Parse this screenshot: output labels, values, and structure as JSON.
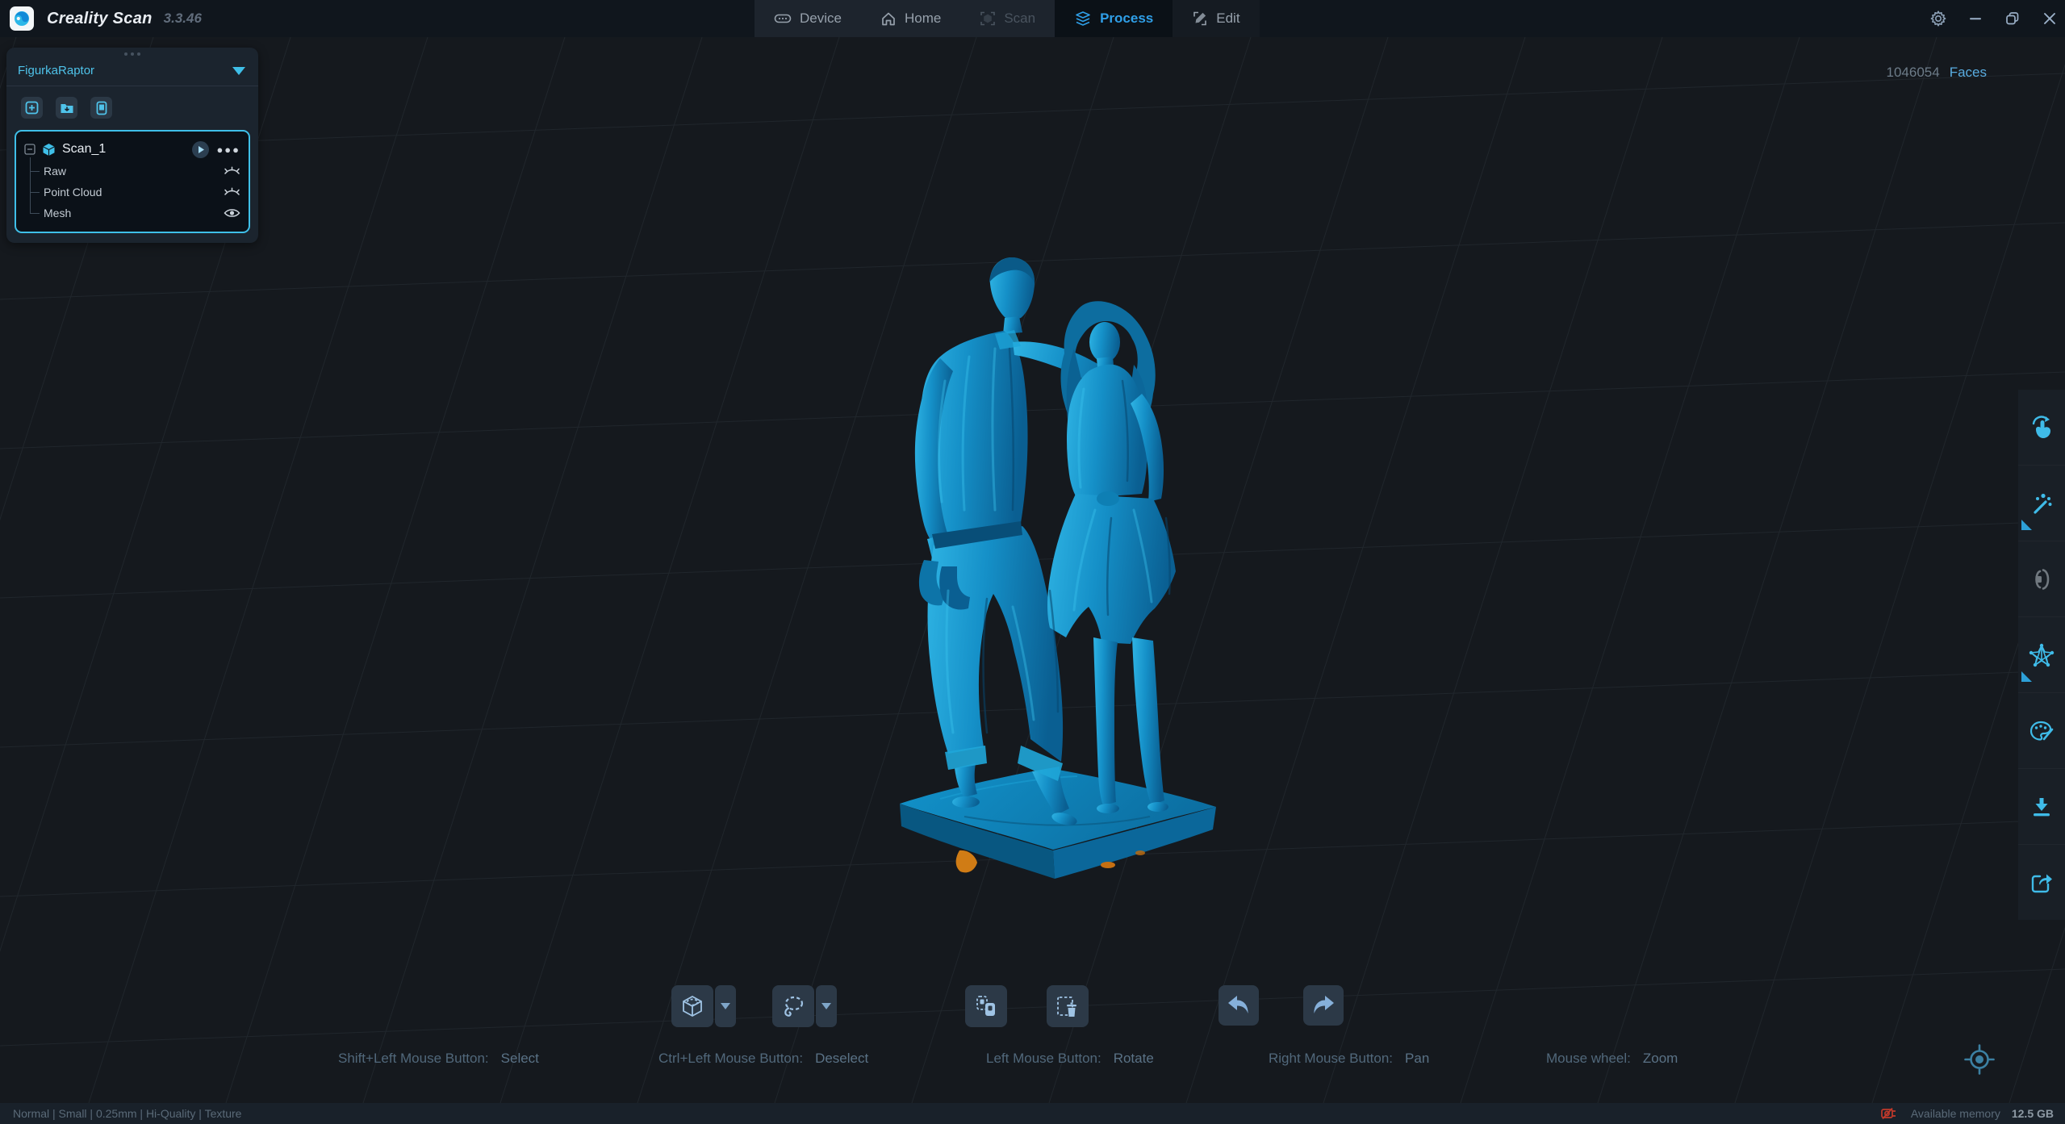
{
  "titlebar": {
    "app_name": "Creality Scan",
    "version": "3.3.46",
    "tabs": [
      {
        "label": "Device",
        "state": "normal"
      },
      {
        "label": "Home",
        "state": "normal"
      },
      {
        "label": "Scan",
        "state": "disabled"
      },
      {
        "label": "Process",
        "state": "active"
      },
      {
        "label": "Edit",
        "state": "normal"
      }
    ]
  },
  "viewport": {
    "faces_value": "1046054",
    "faces_label": "Faces"
  },
  "panel": {
    "project_name": "FigurkaRaptor",
    "scan_name": "Scan_1",
    "layers": [
      {
        "label": "Raw",
        "visible": false
      },
      {
        "label": "Point Cloud",
        "visible": false
      },
      {
        "label": "Mesh",
        "visible": true
      }
    ],
    "action_icons": [
      "new-project-icon",
      "import-folder-icon",
      "device-sync-icon"
    ]
  },
  "right_toolbar_icons": [
    "touch-rotate-icon",
    "magic-wand-icon",
    "compare-icon (disabled)",
    "mesh-star-icon",
    "texture-palette-icon",
    "export-download-icon",
    "share-icon"
  ],
  "bottom_toolbar_icons": [
    "cube-select-icon",
    "lasso-select-icon",
    "invert-selection-icon",
    "delete-selection-icon",
    "undo-icon",
    "redo-icon",
    "locate-view-icon"
  ],
  "hints": [
    {
      "label": "Shift+Left Mouse Button:",
      "action": "Select"
    },
    {
      "label": "Ctrl+Left Mouse Button:",
      "action": "Deselect"
    },
    {
      "label": "Left Mouse Button:",
      "action": "Rotate"
    },
    {
      "label": "Right Mouse Button:",
      "action": "Pan"
    },
    {
      "label": "Mouse wheel:",
      "action": "Zoom"
    }
  ],
  "statusbar": {
    "summary": "Normal | Small | 0.25mm | Hi-Quality | Texture",
    "memory_label": "Available memory",
    "memory_value": "12.5 GB"
  },
  "colors": {
    "accent_blue": "#2f9fe8",
    "panel_cyan": "#4fc3ea",
    "tree_border": "#3fbfe8",
    "model_blue": "#1496cf",
    "model_highlight": "#3ac4ee",
    "marker_orange": "#d07c15",
    "warning_red": "#c0392b",
    "titlebar_bg": "#10161d",
    "viewport_bg": "#15191e"
  }
}
